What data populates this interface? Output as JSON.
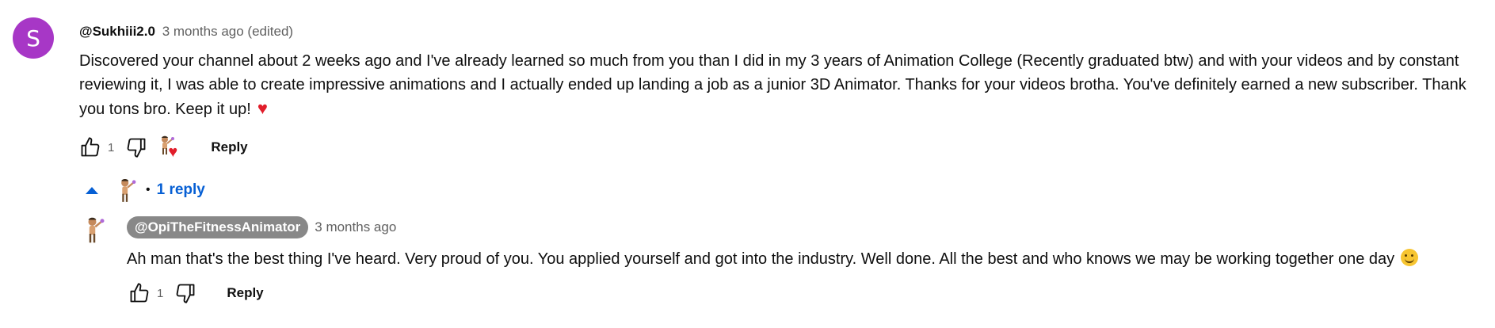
{
  "comment": {
    "avatar_letter": "S",
    "avatar_color": "#a737c6",
    "author": "@Sukhiii2.0",
    "meta": "3 months ago (edited)",
    "text": "Discovered your channel about 2 weeks ago and I've already learned so much from you than I did in my 3 years of Animation College (Recently graduated btw) and with your videos and by constant reviewing it, I was able to create impressive animations and I actually ended up landing a job as a junior 3D Animator. Thanks for your videos brotha. You've definitely earned a new subscriber. Thank you tons bro. Keep it up!",
    "like_count": "1",
    "reply_label": "Reply",
    "creator_heart_icon": "creator-heart-icon"
  },
  "replies_toggle": {
    "separator": "•",
    "label": "1 reply"
  },
  "reply": {
    "author": "@OpiTheFitnessAnimator",
    "meta": "3 months ago",
    "text": "Ah man that's the best thing I've heard. Very proud of you. You applied yourself and got into the industry. Well done. All the best and who knows we may be working together one day",
    "like_count": "1",
    "reply_label": "Reply"
  },
  "colors": {
    "link_blue": "#065fd4",
    "heart_red": "#e11d2a",
    "creator_chip": "#888888"
  }
}
